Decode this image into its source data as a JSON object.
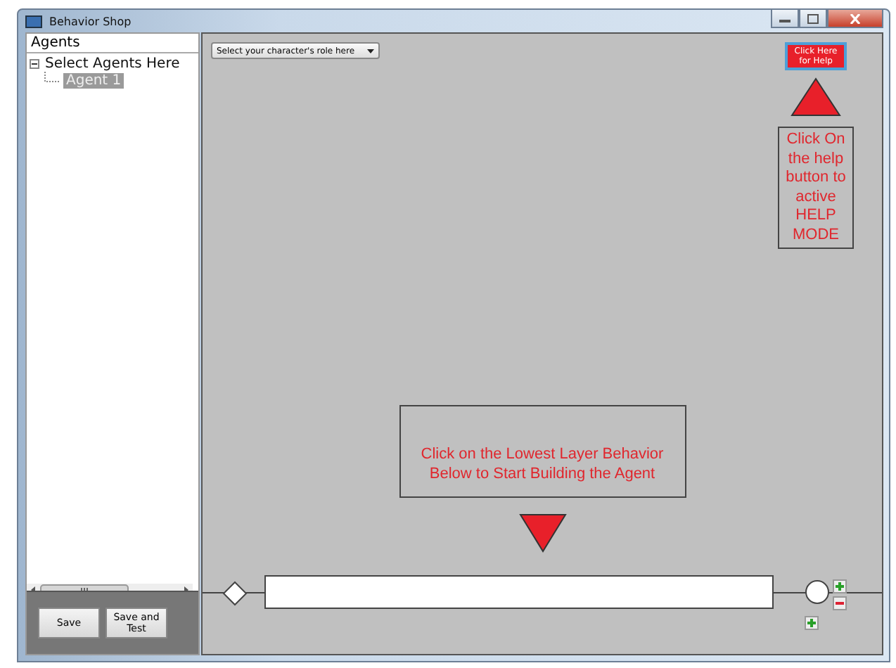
{
  "window": {
    "title": "Behavior Shop"
  },
  "agents_panel": {
    "header": "Agents",
    "tree": [
      {
        "label": "Select Agents Here",
        "expanded": true,
        "selected": false,
        "children": [
          {
            "label": "Agent 1",
            "selected": true
          }
        ]
      }
    ]
  },
  "panel_buttons": [
    "Save",
    "Save and Test"
  ],
  "role_dropdown": {
    "value": "Select your character's role here"
  },
  "help_button": "Click Here for Help",
  "help_note": "Click On the help button to active HELP MODE",
  "instruction": "Click on the Lowest Layer Behavior Below to Start Building the Agent"
}
